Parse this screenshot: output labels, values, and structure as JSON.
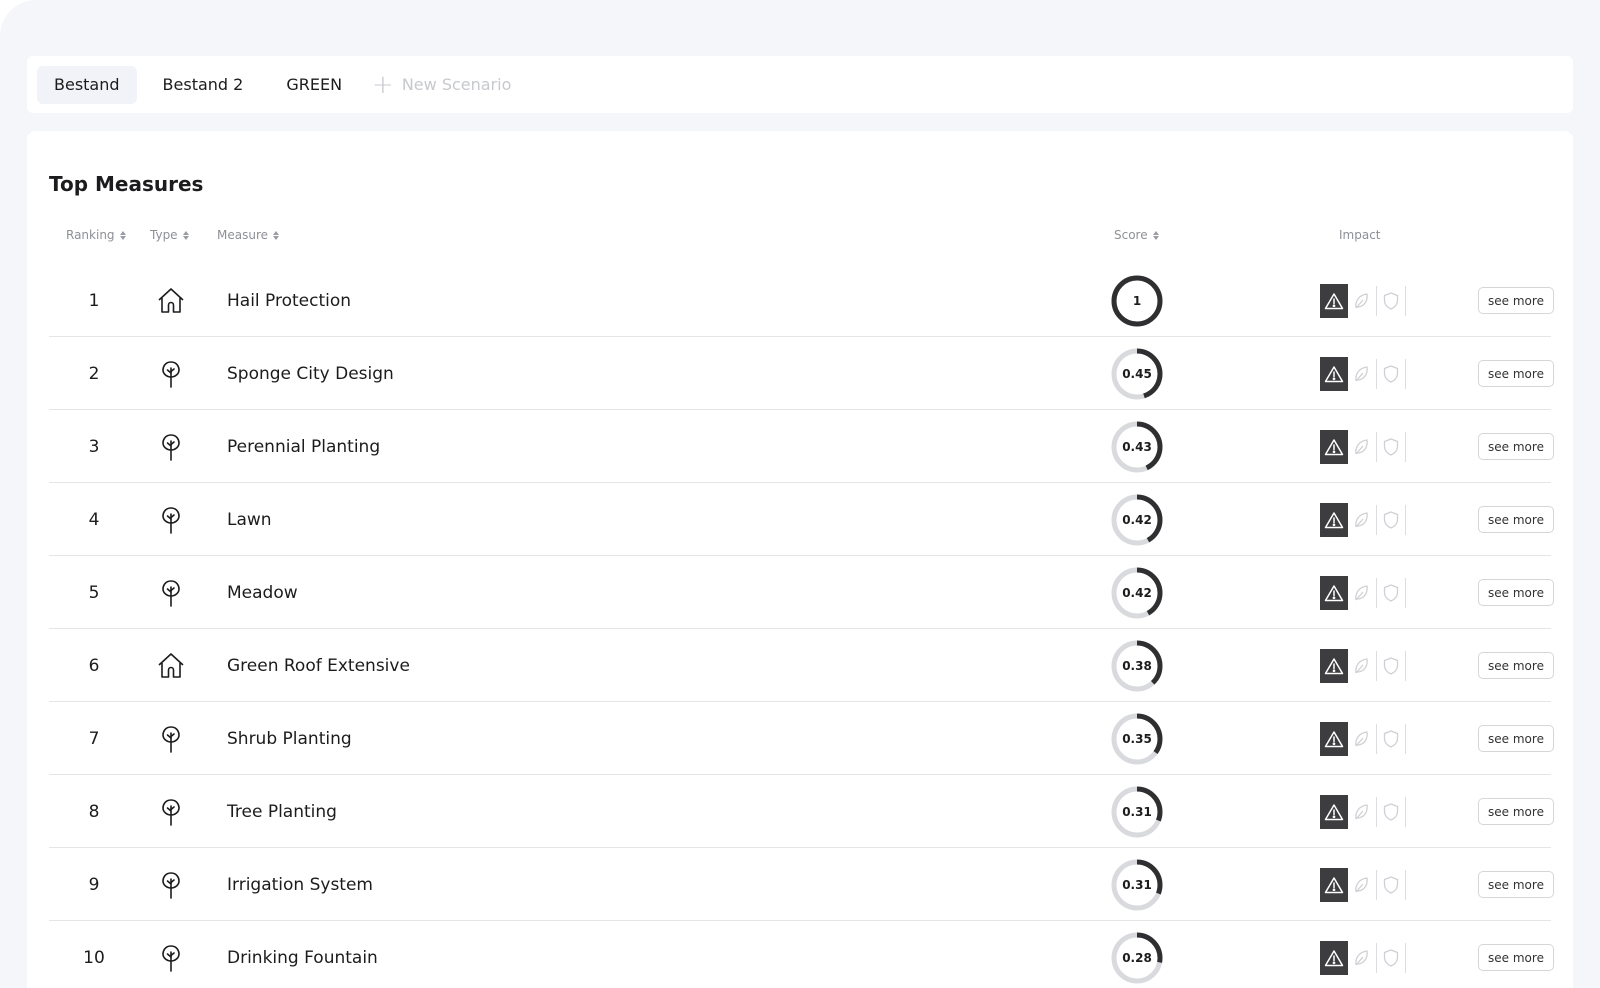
{
  "tabs": [
    {
      "label": "Bestand",
      "active": true
    },
    {
      "label": "Bestand 2",
      "active": false
    },
    {
      "label": "GREEN",
      "active": false
    }
  ],
  "new_tab_label": "New Scenario",
  "panel": {
    "title": "Top Measures",
    "columns": {
      "ranking": "Ranking",
      "type": "Type",
      "measure": "Measure",
      "score": "Score",
      "impact": "Impact"
    },
    "see_more_label": "see more"
  },
  "colors": {
    "accent_dark": "#2f2f31",
    "ring_track": "#d9dadd",
    "impact_active_bg": "#3d3d3f",
    "impact_inactive": "#d0d1d5"
  },
  "measures": [
    {
      "rank": "1",
      "type": "building",
      "type_icon": "house-icon",
      "name": "Hail Protection",
      "score": 1,
      "score_label": "1"
    },
    {
      "rank": "2",
      "type": "nature",
      "type_icon": "tree-icon",
      "name": "Sponge City Design",
      "score": 0.45,
      "score_label": "0.45"
    },
    {
      "rank": "3",
      "type": "nature",
      "type_icon": "tree-icon",
      "name": "Perennial Planting",
      "score": 0.43,
      "score_label": "0.43"
    },
    {
      "rank": "4",
      "type": "nature",
      "type_icon": "tree-icon",
      "name": "Lawn",
      "score": 0.42,
      "score_label": "0.42"
    },
    {
      "rank": "5",
      "type": "nature",
      "type_icon": "tree-icon",
      "name": "Meadow",
      "score": 0.42,
      "score_label": "0.42"
    },
    {
      "rank": "6",
      "type": "building",
      "type_icon": "house-icon",
      "name": "Green Roof Extensive",
      "score": 0.38,
      "score_label": "0.38"
    },
    {
      "rank": "7",
      "type": "nature",
      "type_icon": "tree-icon",
      "name": "Shrub Planting",
      "score": 0.35,
      "score_label": "0.35"
    },
    {
      "rank": "8",
      "type": "nature",
      "type_icon": "tree-icon",
      "name": "Tree Planting",
      "score": 0.31,
      "score_label": "0.31"
    },
    {
      "rank": "9",
      "type": "nature",
      "type_icon": "tree-icon",
      "name": "Irrigation System",
      "score": 0.31,
      "score_label": "0.31"
    },
    {
      "rank": "10",
      "type": "nature",
      "type_icon": "tree-icon",
      "name": "Drinking Fountain",
      "score": 0.28,
      "score_label": "0.28"
    }
  ],
  "impact_icons": [
    {
      "icon": "warning-icon",
      "active": true
    },
    {
      "icon": "leaf-icon",
      "active": false
    },
    {
      "icon": "shield-icon",
      "active": false
    }
  ]
}
